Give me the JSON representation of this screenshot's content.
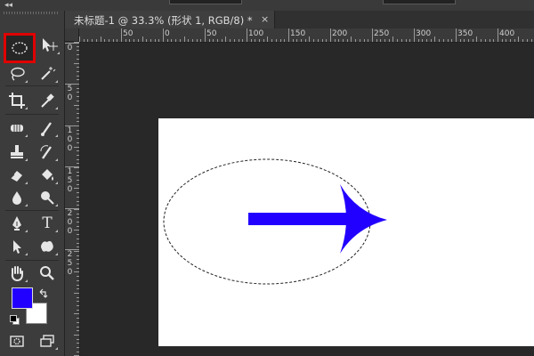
{
  "window": {
    "collapse_icon": "◂◂"
  },
  "document": {
    "tab_title": "未标题-1 @ 33.3% (形状 1, RGB/8) *",
    "close_symbol": "×"
  },
  "rulers": {
    "horizontal_labels": [
      "50",
      "0",
      "50",
      "100",
      "150",
      "200",
      "250",
      "300",
      "350",
      "400"
    ],
    "vertical_labels": [
      "0",
      "5",
      "0",
      "1",
      "0",
      "0",
      "1",
      "5",
      "0",
      "2",
      "0",
      "0",
      "2",
      "5",
      "0"
    ]
  },
  "toolbar": {
    "tools": [
      "elliptical-marquee-icon",
      "move-icon",
      "lasso-icon",
      "magic-wand-icon",
      "crop-icon",
      "eyedropper-icon",
      "spot-healing-icon",
      "brush-icon",
      "clone-stamp-icon",
      "history-brush-icon",
      "eraser-icon",
      "paint-bucket-icon",
      "blur-icon",
      "dodge-icon",
      "pen-icon",
      "type-icon",
      "path-selection-icon",
      "custom-shape-icon",
      "hand-icon",
      "zoom-icon",
      "quick-mask-icon",
      "screen-mode-icon"
    ],
    "selected_tool": "elliptical-marquee-icon",
    "type_tool_glyph": "T",
    "foreground_color": "#2200ff",
    "background_color": "#ffffff"
  },
  "canvas": {
    "background_color": "#ffffff",
    "shape_color": "#2200ff",
    "selection": "ellipse"
  }
}
